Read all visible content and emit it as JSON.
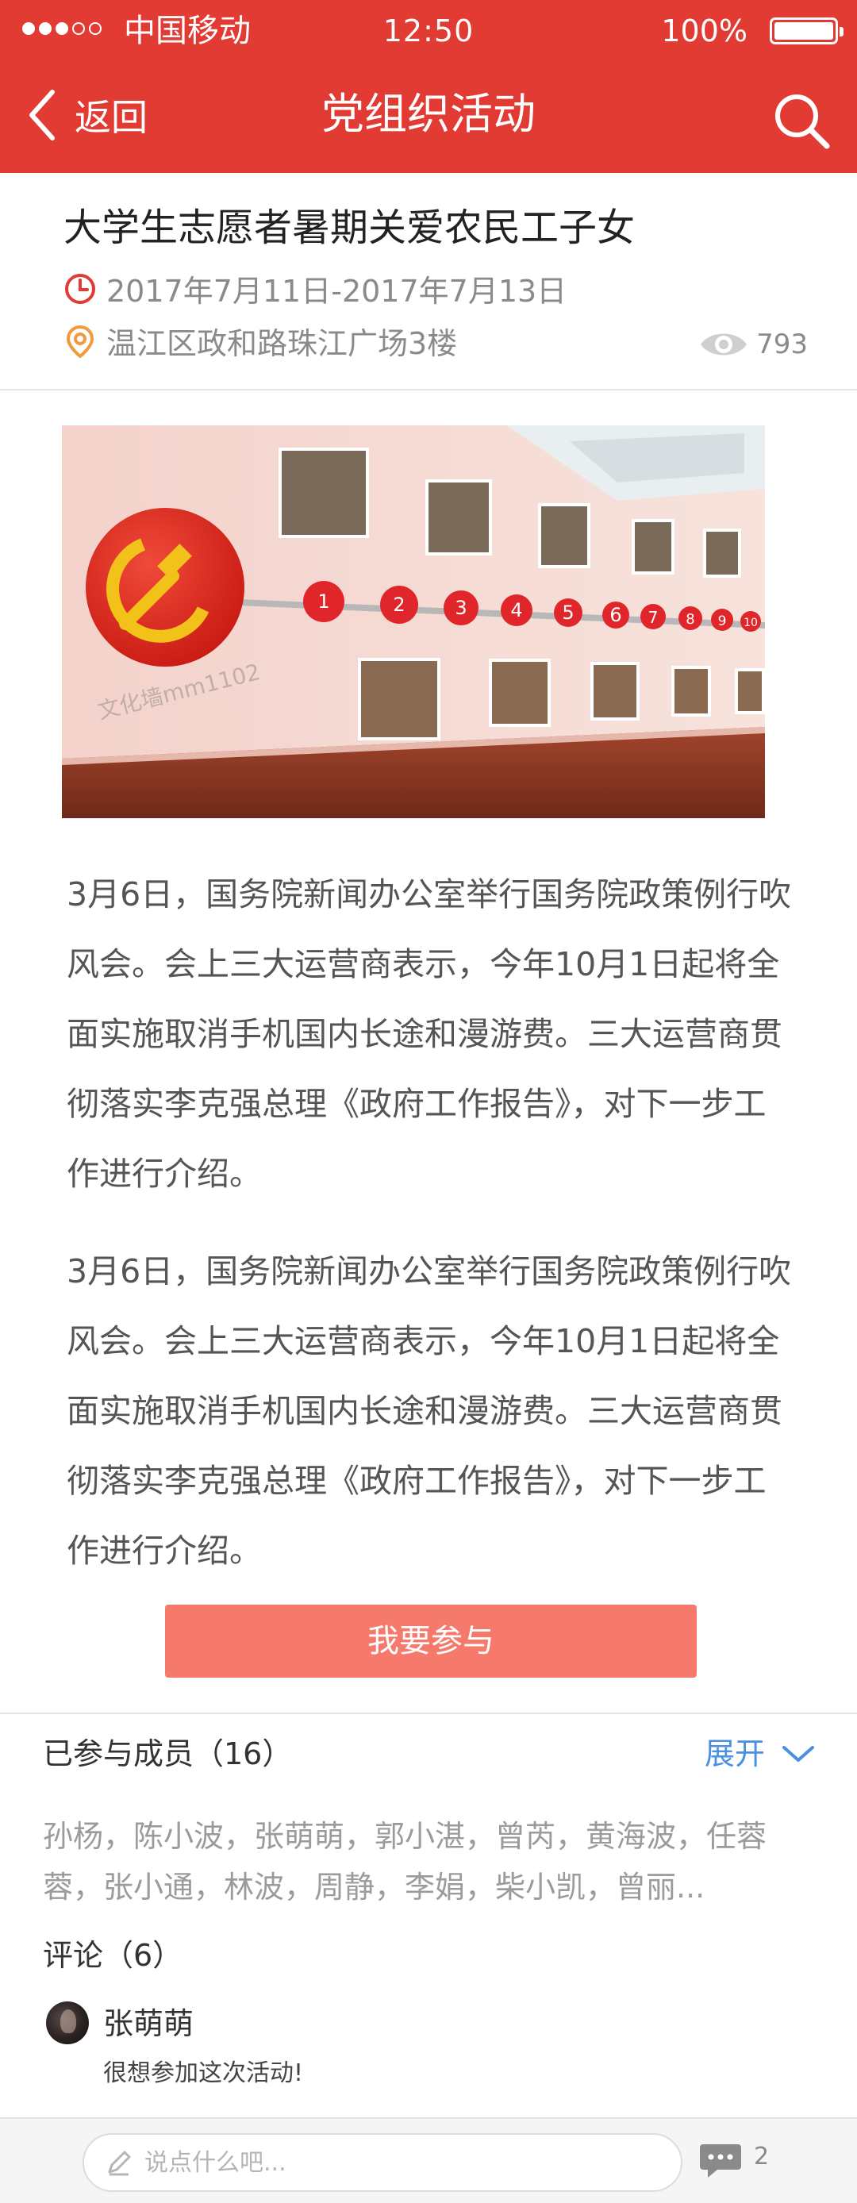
{
  "status_bar": {
    "carrier": "中国移动",
    "time": "12:50",
    "battery": "100%",
    "signal_strength": 3,
    "signal_max": 5
  },
  "nav": {
    "back_label": "返回",
    "title": "党组织活动",
    "icons": {
      "back": "chevron-left-icon",
      "search": "search-icon"
    }
  },
  "activity": {
    "title": "大学生志愿者暑期关爱农民工子女",
    "time_range": "2017年7月11日-2017年7月13日",
    "location": "温江区政和路珠江广场3楼",
    "views": "793",
    "banner_watermark": "文化墙mm1102"
  },
  "article": {
    "paragraphs": [
      "3月6日，国务院新闻办公室举行国务院政策例行吹风会。会上三大运营商表示，今年10月1日起将全面实施取消手机国内长途和漫游费。三大运营商贯彻落实李克强总理《政府工作报告》，对下一步工作进行介绍。",
      "3月6日，国务院新闻办公室举行国务院政策例行吹风会。会上三大运营商表示，今年10月1日起将全面实施取消手机国内长途和漫游费。三大运营商贯彻落实李克强总理《政府工作报告》，对下一步工作进行介绍。"
    ],
    "join_label": "我要参与"
  },
  "members": {
    "header": "已参与成员（16）",
    "expand_label": "展开",
    "list": "孙杨，陈小波，张萌萌，郭小湛，曾芮，黄海波，任蓉蓉，张小通，林波，周静，李娟，柴小凯，曾丽..."
  },
  "comments": {
    "header": "评论（6）",
    "items": [
      {
        "name": "张萌萌",
        "text": "很想参加这次活动!"
      }
    ]
  },
  "input_bar": {
    "placeholder": "说点什么吧...",
    "comment_count": "2"
  },
  "colors": {
    "brand_red": "#e23b33",
    "button_salmon": "#f57a6c",
    "link_blue": "#4a90e2",
    "muted_gray": "#9b9b9b"
  }
}
